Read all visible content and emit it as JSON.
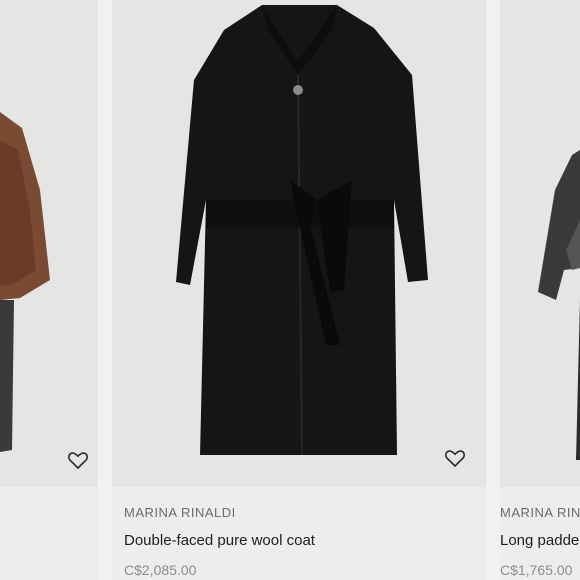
{
  "products": [
    {
      "brand": "",
      "name": "",
      "price": "",
      "favorite_icon": "heart-outline-icon",
      "image_color": "#7a4a33"
    },
    {
      "brand": "MARINA RINALDI",
      "name": "Double-faced pure wool coat",
      "price": "C$2,085.00",
      "favorite_icon": "heart-outline-icon",
      "image_color": "#151515"
    },
    {
      "brand": "MARINA RINA",
      "name": "Long padde",
      "price": "C$1,765.00",
      "favorite_icon": "heart-outline-icon",
      "image_color": "#3a3a3a"
    }
  ]
}
